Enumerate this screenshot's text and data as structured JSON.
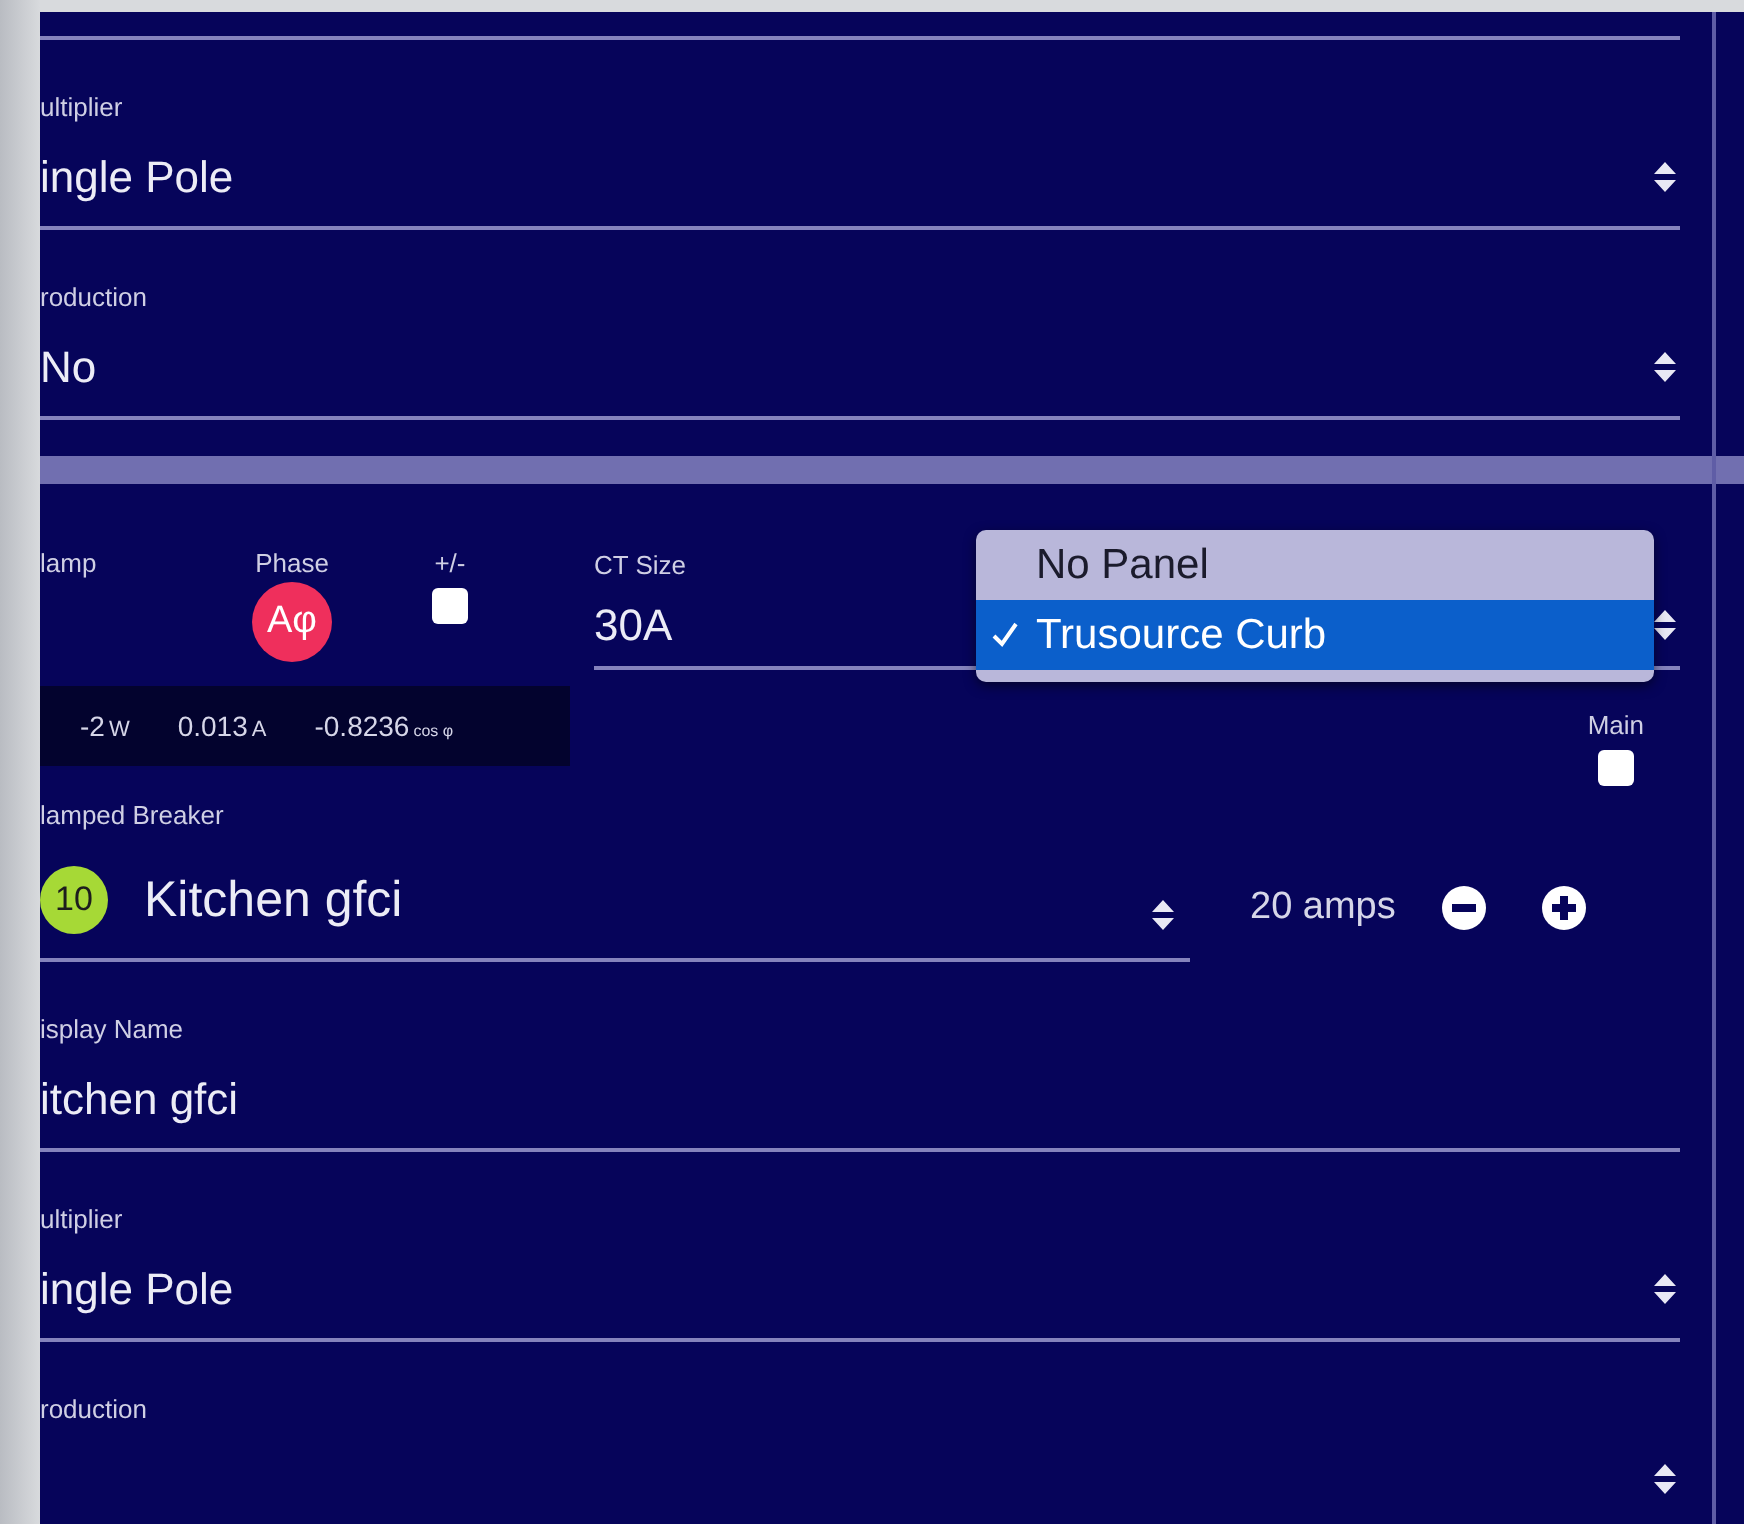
{
  "top_section": {
    "fields": [
      {
        "kind": "select",
        "label": "ultiplier",
        "value": "ingle Pole"
      },
      {
        "kind": "select",
        "label": "roduction",
        "value": "No"
      }
    ]
  },
  "clamp_section": {
    "clamp": {
      "label": "lamp"
    },
    "phase": {
      "label": "Phase",
      "badge": "Aφ",
      "color": "#ef2f5c"
    },
    "polarity": {
      "label": "+/-",
      "checked": false
    },
    "ct_size": {
      "label": "CT Size",
      "value": "30A"
    },
    "panel_menu": {
      "options": [
        {
          "label": "No Panel",
          "selected": false
        },
        {
          "label": "Trusource Curb",
          "selected": true
        }
      ]
    },
    "readings": [
      {
        "value": "-2",
        "unit": "W"
      },
      {
        "value": "0.013",
        "unit": "A"
      },
      {
        "value": "-0.8236",
        "unit": "cos φ"
      }
    ],
    "main": {
      "label": "Main",
      "checked": false
    },
    "breaker": {
      "label": "lamped Breaker",
      "number": "10",
      "color": "#a6d936",
      "value": "Kitchen gfci",
      "amps": "20 amps"
    },
    "fields": [
      {
        "kind": "text",
        "label": "isplay Name",
        "value": "itchen gfci"
      },
      {
        "kind": "select",
        "label": "ultiplier",
        "value": "ingle Pole"
      },
      {
        "kind": "select",
        "label": "roduction"
      }
    ]
  }
}
